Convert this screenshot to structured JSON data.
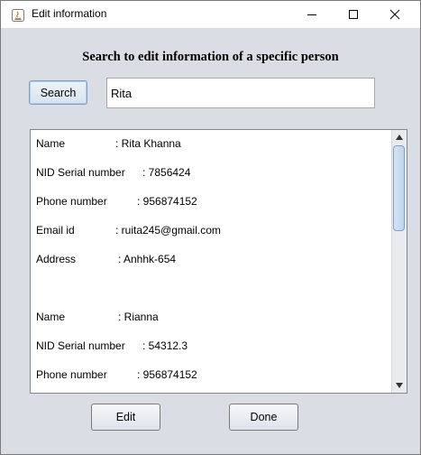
{
  "window": {
    "title": "Edit information",
    "controls": {
      "minimize": "minimize",
      "maximize": "maximize",
      "close": "close"
    }
  },
  "heading": "Search to edit information of a specific person",
  "search": {
    "button_label": "Search",
    "value": "Rita"
  },
  "results": [
    {
      "label": "Name",
      "value": ": Rita Khanna"
    },
    {
      "label": "NID Serial number",
      "value": ": 7856424"
    },
    {
      "label": "Phone number",
      "value": ": 956874152"
    },
    {
      "label": "Email id",
      "value": ": ruita245@gmail.com"
    },
    {
      "label": "Address",
      "value": ": Anhhk-654"
    },
    {
      "label": "Name",
      "value": ": Rianna"
    },
    {
      "label": "NID Serial number",
      "value": ": 54312.3"
    },
    {
      "label": "Phone number",
      "value": ": 956874152"
    }
  ],
  "buttons": {
    "edit": "Edit",
    "done": "Done"
  },
  "colors": {
    "window_bg": "#dadde3",
    "scroll_thumb": "#bfd3ea"
  }
}
